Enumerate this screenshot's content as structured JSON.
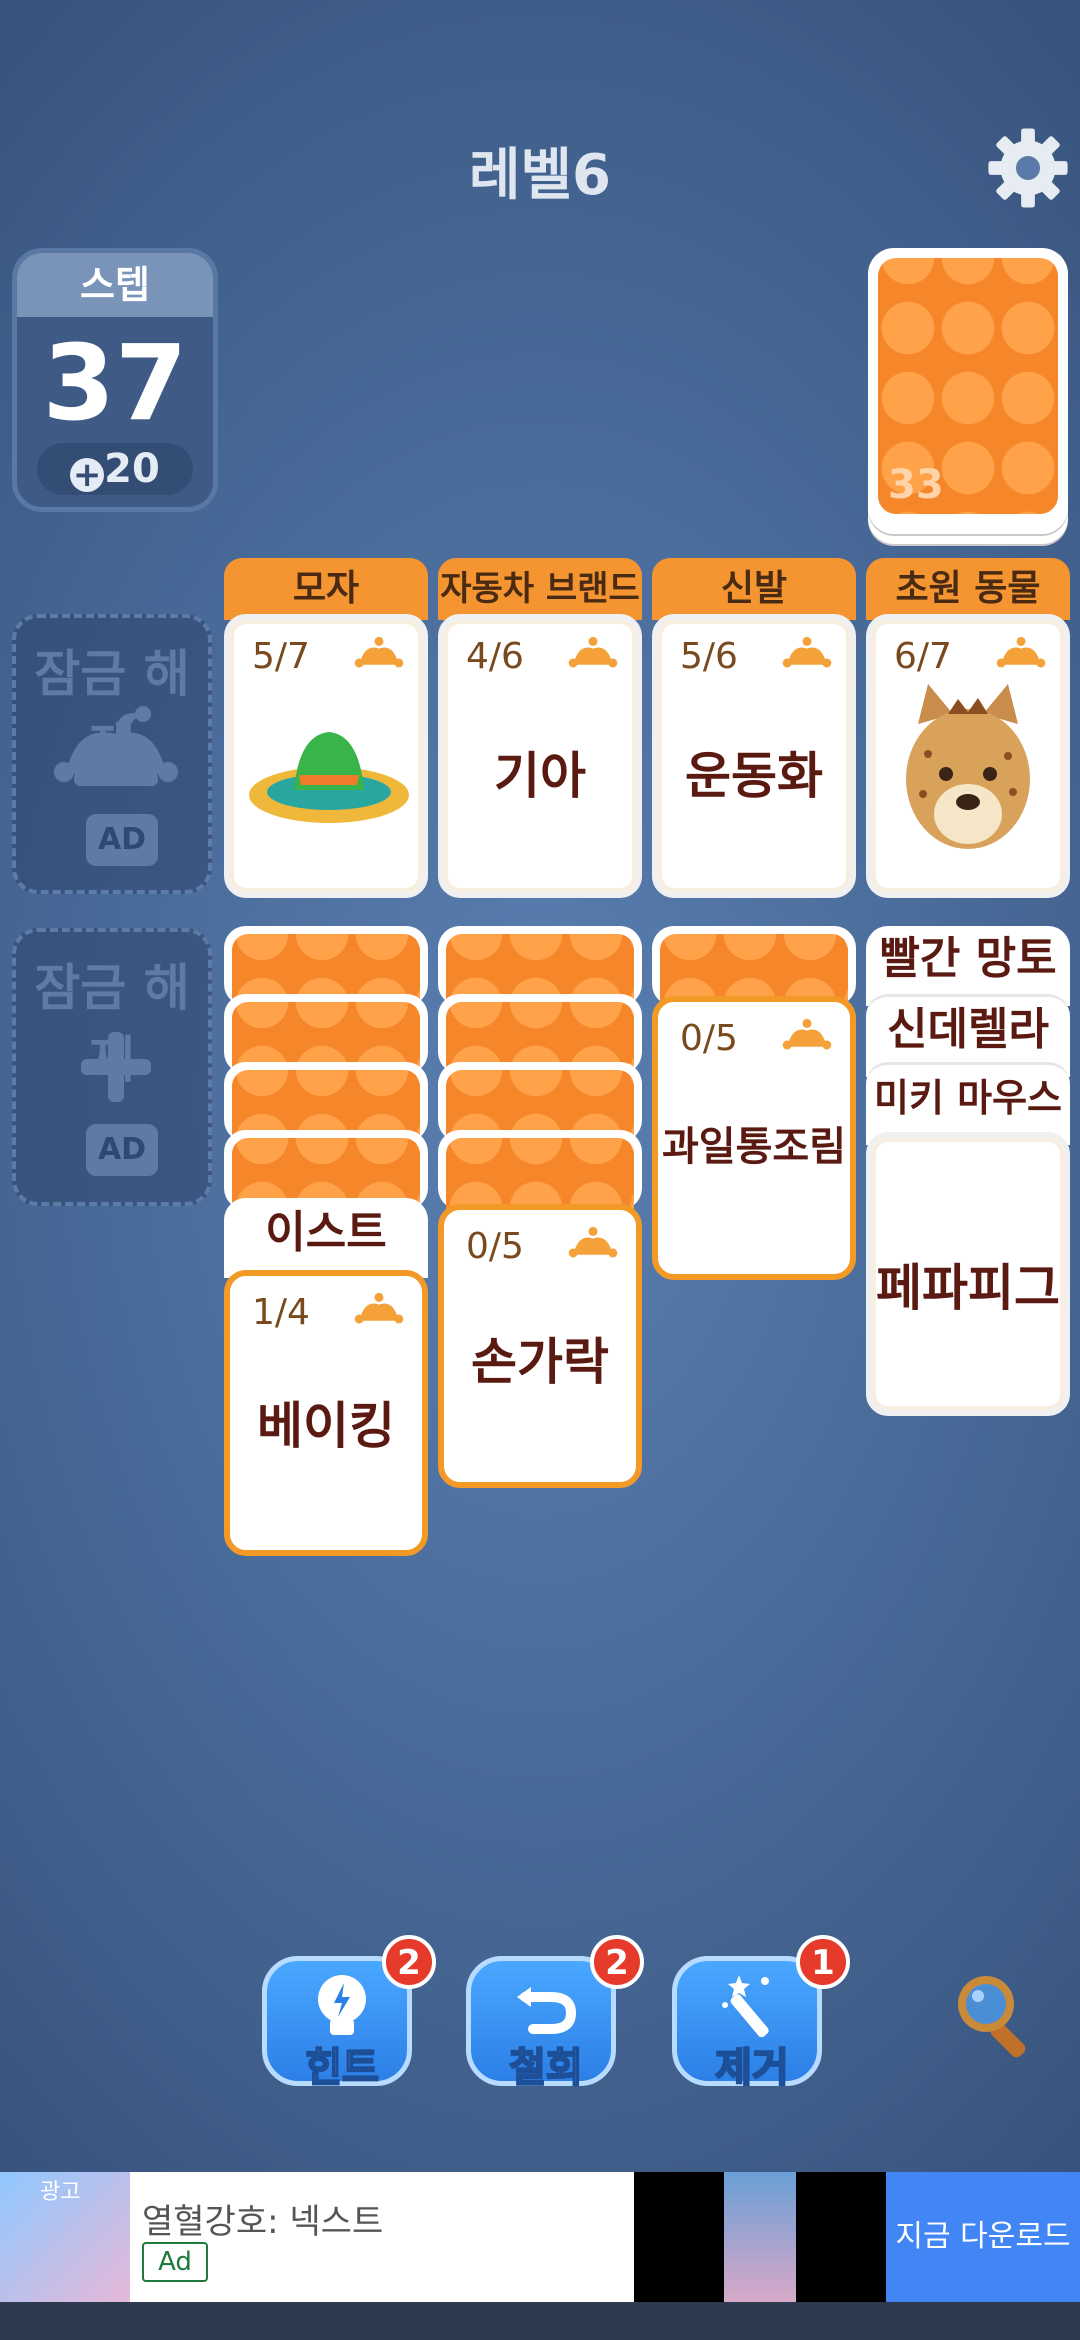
{
  "level": {
    "title": "레벨6"
  },
  "steps": {
    "label": "스텝",
    "count": "37",
    "bonus": "20"
  },
  "deck": {
    "count": "33"
  },
  "locked_slots": [
    {
      "label": "잠금 해제",
      "ad": "AD"
    },
    {
      "label": "잠금 해제",
      "ad": "AD"
    }
  ],
  "foundations": [
    {
      "category": "모자",
      "progress": "5/7"
    },
    {
      "category": "자동차 브랜드",
      "progress": "4/6",
      "word": "기아"
    },
    {
      "category": "신발",
      "progress": "5/6",
      "word": "운동화"
    },
    {
      "category": "초원 동물",
      "progress": "6/7"
    }
  ],
  "columns": {
    "col1": {
      "strip": "이스트",
      "card_progress": "1/4",
      "card_word": "베이킹"
    },
    "col2": {
      "card_progress": "0/5",
      "card_word": "손가락"
    },
    "col3": {
      "card_progress": "0/5",
      "card_word": "과일통조림"
    },
    "col4": {
      "strips": [
        "빨간 망토",
        "신데렐라",
        "미키 마우스"
      ],
      "card_word": "페파피그"
    }
  },
  "buttons": [
    {
      "label": "힌트",
      "badge": "2",
      "icon": "lightbulb-icon"
    },
    {
      "label": "철회",
      "badge": "2",
      "icon": "undo-icon"
    },
    {
      "label": "제거",
      "badge": "1",
      "icon": "magic-wand-icon"
    }
  ],
  "ad_banner": {
    "tag": "광고",
    "title": "열혈강호: 넥스트",
    "ad_label": "Ad",
    "cta": "지금 다운로드"
  },
  "colors": {
    "accent": "#f49531",
    "button": "#2c7fe6",
    "badge": "#e63a2a",
    "cta": "#4285f4"
  }
}
